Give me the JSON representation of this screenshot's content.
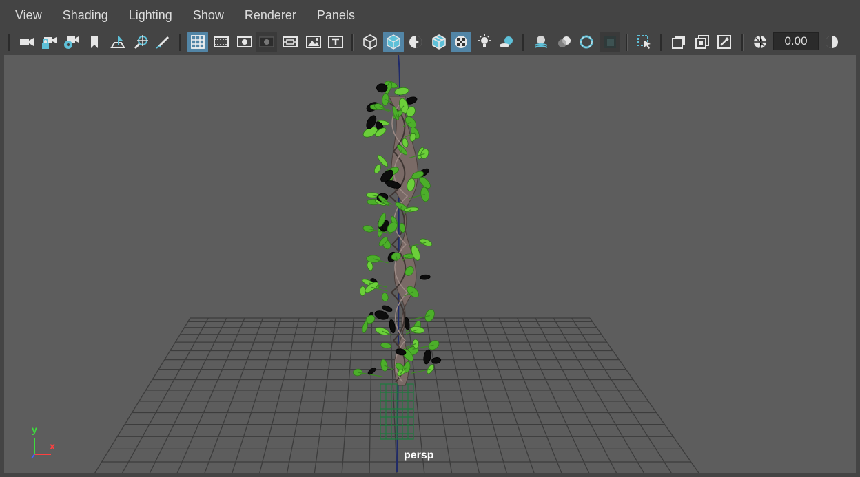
{
  "menubar": {
    "items": [
      {
        "id": "view",
        "label": "View"
      },
      {
        "id": "shading",
        "label": "Shading"
      },
      {
        "id": "lighting",
        "label": "Lighting"
      },
      {
        "id": "show",
        "label": "Show"
      },
      {
        "id": "renderer",
        "label": "Renderer"
      },
      {
        "id": "panels",
        "label": "Panels"
      }
    ]
  },
  "toolbar": {
    "exposure_value": "0.00",
    "icons": [
      "camera-icon",
      "lock-camera-icon",
      "camera-attributes-icon",
      "bookmark-icon",
      "image-plane-icon",
      "2d-pan-zoom-icon",
      "grease-pencil-icon",
      "grid-icon",
      "film-gate-icon",
      "resolution-gate-icon",
      "gate-mask-icon",
      "field-chart-icon",
      "safe-action-icon",
      "safe-title-icon",
      "wireframe-icon",
      "smooth-shade-icon",
      "default-material-icon",
      "wireframe-on-shaded-icon",
      "textured-icon",
      "use-all-lights-icon",
      "shadows-icon",
      "screen-space-ao-icon",
      "motion-blur-icon",
      "anti-aliasing-icon",
      "depth-of-field-icon",
      "isolate-select-icon",
      "xray-icon",
      "xray-active-components-icon",
      "xray-joints-icon",
      "exposure-icon",
      "gamma-icon"
    ]
  },
  "viewport": {
    "camera_label": "persp",
    "axis": {
      "y": "y",
      "x": "x"
    },
    "colors": {
      "background": "#5d5d5d",
      "grid": "#3c3c3c",
      "leaf": "#4caf2a",
      "trunk": "#7a6a66"
    }
  }
}
